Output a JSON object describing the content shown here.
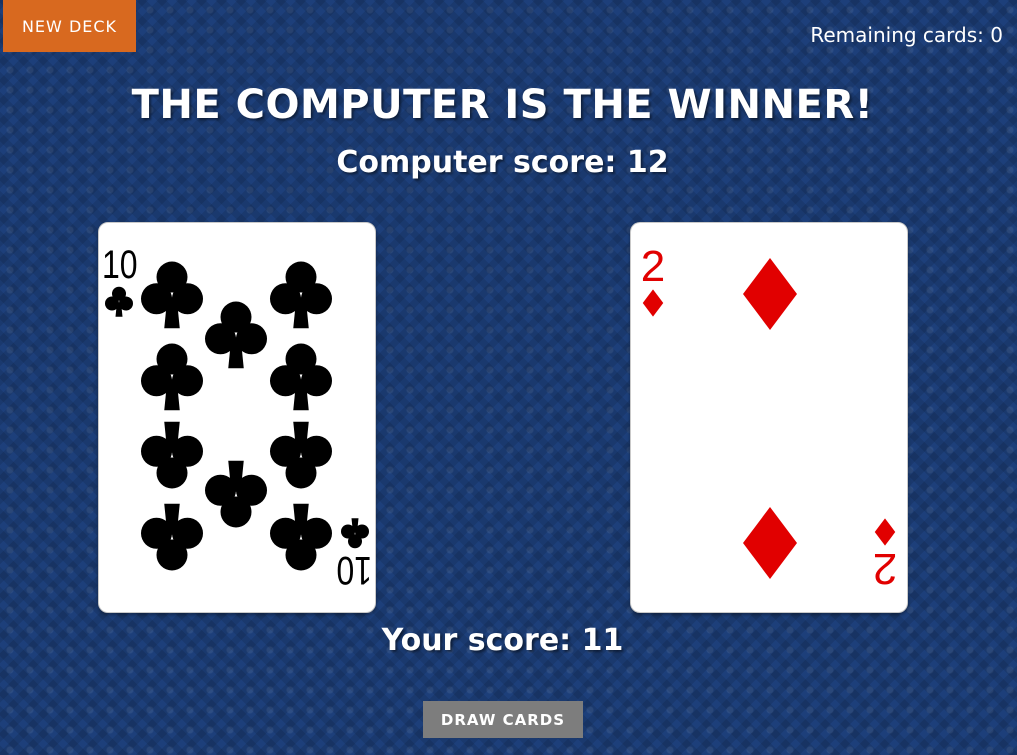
{
  "toolbar": {
    "new_deck_label": "NEW DECK",
    "remaining_label": "Remaining cards:",
    "remaining_count": "0"
  },
  "game": {
    "result_title": "THE COMPUTER IS THE WINNER!",
    "computer_score_label": "Computer score:",
    "computer_score": "12",
    "player_score_label": "Your score:",
    "player_score": "11",
    "draw_label": "DRAW CARDS"
  },
  "cards": {
    "computer": {
      "rank": "10",
      "suit": "clubs",
      "color": "#000000"
    },
    "player": {
      "rank": "2",
      "suit": "diamonds",
      "color": "#e10000"
    }
  },
  "colors": {
    "background": "#1d3f7a",
    "new_deck_button": "#d8691f",
    "draw_button": "#7d7d7d",
    "red_suit": "#e10000",
    "black_suit": "#000000"
  }
}
